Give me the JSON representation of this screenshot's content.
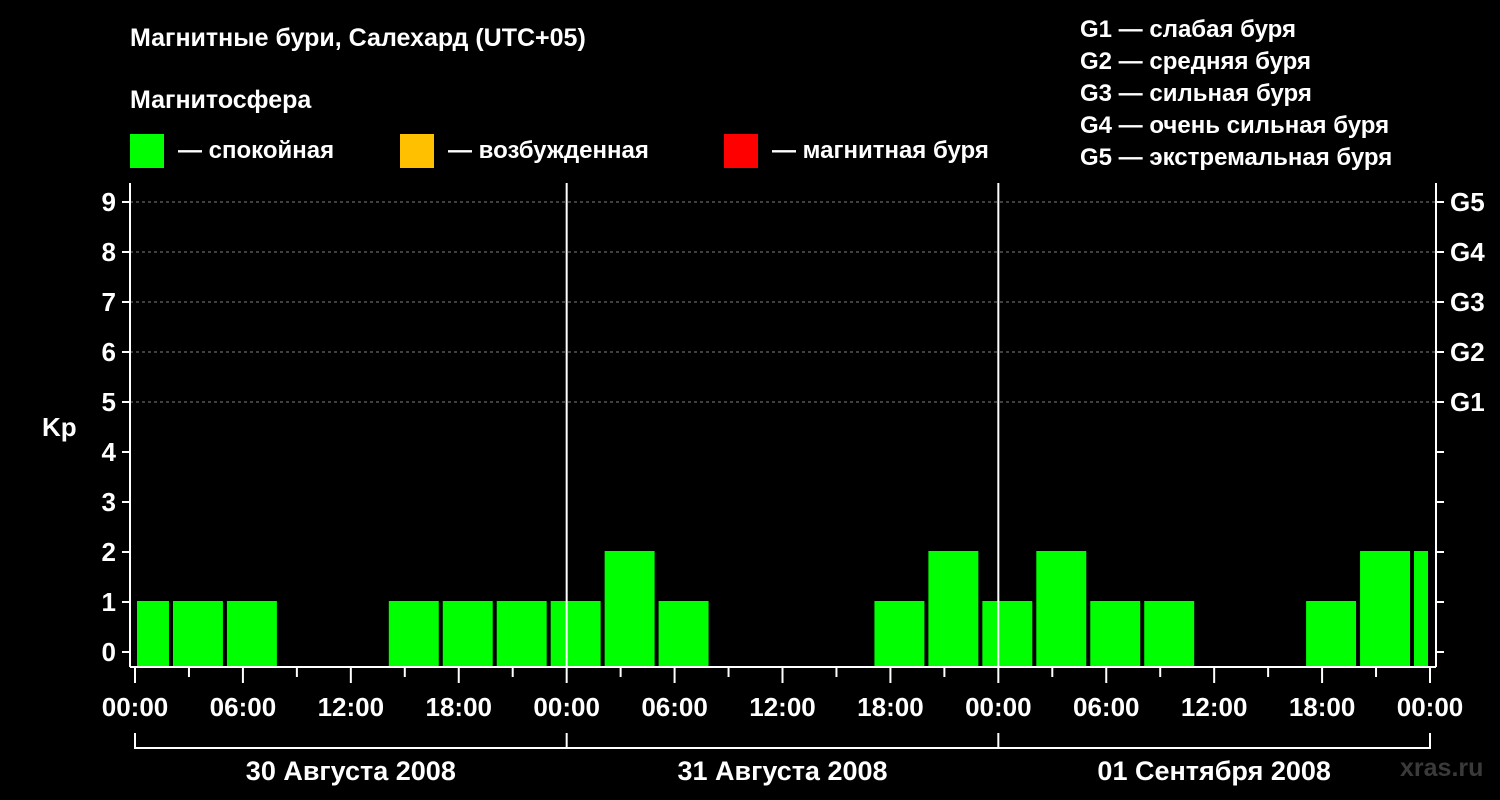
{
  "title": "Магнитные бури, Салехард (UTC+05)",
  "subtitle": "Магнитосфера",
  "legend": [
    {
      "color": "#00ff00",
      "label": "— спокойная"
    },
    {
      "color": "#ffc000",
      "label": "— возбужденная"
    },
    {
      "color": "#ff0000",
      "label": "— магнитная буря"
    }
  ],
  "g_legend": [
    "G1 — слабая буря",
    "G2 — средняя буря",
    "G3 — сильная буря",
    "G4 — очень сильная буря",
    "G5 — экстремальная буря"
  ],
  "watermark": "xras.ru",
  "chart_data": {
    "type": "bar",
    "title": "Магнитные бури, Салехард (UTC+05)",
    "ylabel": "Kp",
    "ylim": [
      0,
      9.3
    ],
    "yticks": [
      0,
      1,
      2,
      3,
      4,
      5,
      6,
      7,
      8,
      9
    ],
    "right_ticks": [
      {
        "value": 5,
        "label": "G1"
      },
      {
        "value": 6,
        "label": "G2"
      },
      {
        "value": 7,
        "label": "G3"
      },
      {
        "value": 8,
        "label": "G4"
      },
      {
        "value": 9,
        "label": "G5"
      }
    ],
    "grid": "dashed horizontal at Kp 5–9",
    "xlim_hours": [
      0,
      72
    ],
    "xtick_labels": [
      "00:00",
      "06:00",
      "12:00",
      "18:00",
      "00:00",
      "06:00",
      "12:00",
      "18:00",
      "00:00",
      "06:00",
      "12:00",
      "18:00",
      "00:00"
    ],
    "days": [
      "30 Августа 2008",
      "31 Августа 2008",
      "01 Сентября 2008"
    ],
    "bar_color": "#00ff00",
    "bars": [
      {
        "start": 0,
        "end": 2,
        "kp": 1
      },
      {
        "start": 2,
        "end": 5,
        "kp": 1
      },
      {
        "start": 5,
        "end": 8,
        "kp": 1
      },
      {
        "start": 8,
        "end": 11,
        "kp": 0
      },
      {
        "start": 11,
        "end": 14,
        "kp": 0
      },
      {
        "start": 14,
        "end": 17,
        "kp": 1
      },
      {
        "start": 17,
        "end": 20,
        "kp": 1
      },
      {
        "start": 20,
        "end": 23,
        "kp": 1
      },
      {
        "start": 23,
        "end": 26,
        "kp": 1
      },
      {
        "start": 26,
        "end": 29,
        "kp": 2
      },
      {
        "start": 29,
        "end": 32,
        "kp": 1
      },
      {
        "start": 32,
        "end": 35,
        "kp": 0
      },
      {
        "start": 35,
        "end": 38,
        "kp": 0
      },
      {
        "start": 38,
        "end": 41,
        "kp": 0
      },
      {
        "start": 41,
        "end": 44,
        "kp": 1
      },
      {
        "start": 44,
        "end": 47,
        "kp": 2
      },
      {
        "start": 47,
        "end": 50,
        "kp": 1
      },
      {
        "start": 50,
        "end": 53,
        "kp": 2
      },
      {
        "start": 53,
        "end": 56,
        "kp": 1
      },
      {
        "start": 56,
        "end": 59,
        "kp": 1
      },
      {
        "start": 59,
        "end": 62,
        "kp": 0
      },
      {
        "start": 62,
        "end": 65,
        "kp": 0
      },
      {
        "start": 65,
        "end": 68,
        "kp": 1
      },
      {
        "start": 68,
        "end": 71,
        "kp": 2
      },
      {
        "start": 71,
        "end": 72,
        "kp": 2
      }
    ]
  }
}
